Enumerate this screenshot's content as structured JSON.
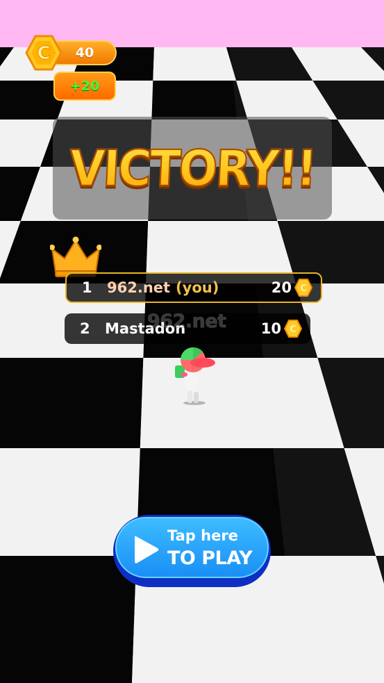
{
  "hud": {
    "coins": "40",
    "reward": "+20"
  },
  "banner": {
    "title": "VICTORY!!"
  },
  "leaderboard": [
    {
      "rank": "1",
      "name": "962.net",
      "tag": "(you)",
      "score": "20"
    },
    {
      "rank": "2",
      "name": "Mastadon",
      "tag": "",
      "score": "10"
    }
  ],
  "watermark": "962.net",
  "play_button": {
    "line1": "Tap here",
    "line2": "TO PLAY"
  },
  "icons": {
    "coin": "coin-icon",
    "crown": "crown-icon",
    "play": "play-icon"
  },
  "colors": {
    "sky": "#ffb8f2",
    "tile_dark": "#050505",
    "tile_light": "#f2f2f2",
    "gold": "#ffc21a",
    "button_blue": "#1a8ff5"
  }
}
